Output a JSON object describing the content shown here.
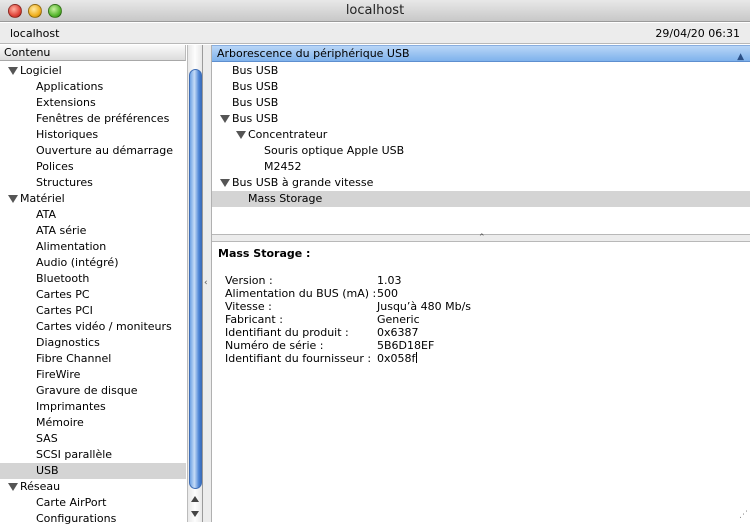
{
  "window": {
    "title": "localhost"
  },
  "infobar": {
    "host": "localhost",
    "datetime": "29/04/20 06:31"
  },
  "sidebar": {
    "header": "Contenu",
    "tree": [
      {
        "type": "category",
        "label": "Logiciel"
      },
      {
        "type": "item",
        "label": "Applications"
      },
      {
        "type": "item",
        "label": "Extensions"
      },
      {
        "type": "item",
        "label": "Fenêtres de préférences"
      },
      {
        "type": "item",
        "label": "Historiques"
      },
      {
        "type": "item",
        "label": "Ouverture au démarrage"
      },
      {
        "type": "item",
        "label": "Polices"
      },
      {
        "type": "item",
        "label": "Structures"
      },
      {
        "type": "category",
        "label": "Matériel"
      },
      {
        "type": "item",
        "label": "ATA"
      },
      {
        "type": "item",
        "label": "ATA série"
      },
      {
        "type": "item",
        "label": "Alimentation"
      },
      {
        "type": "item",
        "label": "Audio (intégré)"
      },
      {
        "type": "item",
        "label": "Bluetooth"
      },
      {
        "type": "item",
        "label": "Cartes PC"
      },
      {
        "type": "item",
        "label": "Cartes PCI"
      },
      {
        "type": "item",
        "label": "Cartes vidéo / moniteurs"
      },
      {
        "type": "item",
        "label": "Diagnostics"
      },
      {
        "type": "item",
        "label": "Fibre Channel"
      },
      {
        "type": "item",
        "label": "FireWire"
      },
      {
        "type": "item",
        "label": "Gravure de disque"
      },
      {
        "type": "item",
        "label": "Imprimantes"
      },
      {
        "type": "item",
        "label": "Mémoire"
      },
      {
        "type": "item",
        "label": "SAS"
      },
      {
        "type": "item",
        "label": "SCSI parallèle"
      },
      {
        "type": "item",
        "label": "USB",
        "selected": true
      },
      {
        "type": "category",
        "label": "Réseau"
      },
      {
        "type": "item",
        "label": "Carte AirPort"
      },
      {
        "type": "item",
        "label": "Configurations"
      }
    ]
  },
  "usb_tree": {
    "header": "Arborescence du périphérique USB",
    "rows": [
      {
        "label": "Bus USB",
        "level": 0,
        "expanded": false
      },
      {
        "label": "Bus USB",
        "level": 0,
        "expanded": false
      },
      {
        "label": "Bus USB",
        "level": 0,
        "expanded": false
      },
      {
        "label": "Bus USB",
        "level": 0,
        "expanded": true
      },
      {
        "label": "Concentrateur",
        "level": 1,
        "expanded": true
      },
      {
        "label": "Souris optique Apple USB",
        "level": 2,
        "expanded": false
      },
      {
        "label": "M2452",
        "level": 2,
        "expanded": false
      },
      {
        "label": "Bus USB à grande vitesse",
        "level": 0,
        "expanded": true
      },
      {
        "label": "Mass Storage",
        "level": 1,
        "expanded": false,
        "selected": true
      }
    ]
  },
  "details": {
    "title": "Mass Storage :",
    "fields": [
      {
        "key": "Version :",
        "value": "1.03"
      },
      {
        "key": "Alimentation du BUS (mA) :",
        "value": "500"
      },
      {
        "key": "Vitesse :",
        "value": "Jusqu’à 480 Mb/s"
      },
      {
        "key": "Fabricant :",
        "value": "Generic"
      },
      {
        "key": "Identifiant du produit :",
        "value": "0x6387"
      },
      {
        "key": "Numéro de série :",
        "value": "5B6D18EF"
      },
      {
        "key": "Identifiant du fournisseur :",
        "value": "0x058f"
      }
    ]
  }
}
